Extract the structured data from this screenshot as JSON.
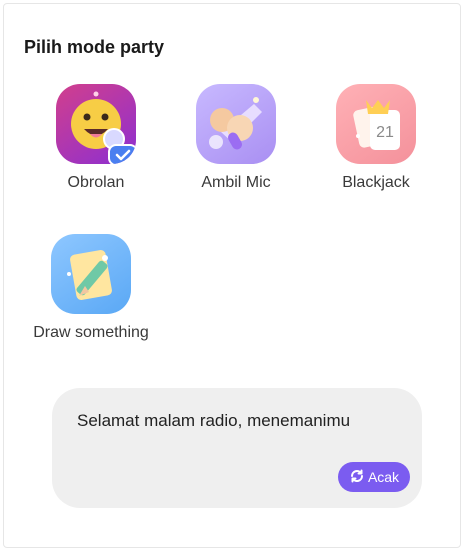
{
  "header": {
    "title": "Pilih mode party"
  },
  "modes": [
    {
      "label": "Obrolan",
      "icon": "smiling-face-microphone-icon",
      "selected": true
    },
    {
      "label": "Ambil Mic",
      "icon": "hand-grabbing-microphone-icon",
      "selected": false
    },
    {
      "label": "Blackjack",
      "icon": "playing-cards-icon",
      "selected": false
    },
    {
      "label": "Draw something",
      "icon": "pencil-drawing-icon",
      "selected": false
    }
  ],
  "chat": {
    "message": "Selamat malam radio, menemanimu",
    "random_button": "Acak",
    "accent": "#7b5cf0"
  }
}
